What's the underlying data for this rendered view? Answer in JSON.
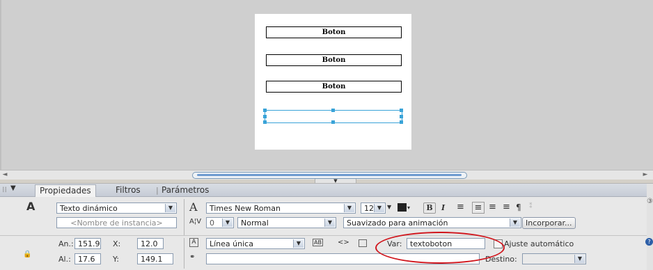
{
  "stage": {
    "buttons": [
      {
        "label": "Boton"
      },
      {
        "label": "Boton"
      },
      {
        "label": "Boton"
      }
    ]
  },
  "scrollbar": {
    "left_arrow": "◄",
    "right_arrow": "►"
  },
  "panel": {
    "menu_glyph": "▼",
    "tabs": [
      {
        "label": "Propiedades"
      },
      {
        "label": "Filtros"
      },
      {
        "label": "Parámetros"
      }
    ],
    "text_type": "Texto dinámico",
    "instance_placeholder": "<Nombre de instancia>",
    "font_name": "Times New Roman",
    "font_size": "12",
    "letter_spacing": "0",
    "char_position": "Normal",
    "antialias": "Suavizado para animación",
    "embed_button": "Incorporar...",
    "width_label": "An.:",
    "width_value": "151.9",
    "height_label": "Al.:",
    "height_value": "17.6",
    "x_label": "X:",
    "x_value": "12.0",
    "y_label": "Y:",
    "y_value": "149.1",
    "line_type": "Línea única",
    "var_label": "Var:",
    "var_value": "textoboton",
    "autofit_label": "Ajuste automático",
    "destino_label": "Destino:",
    "bold_glyph": "B",
    "italic_glyph": "I",
    "paragraph_glyph": "¶",
    "text_tool_glyph": "A",
    "selectable_glyph": "AB",
    "html_glyph": "<>"
  },
  "annotation": {
    "color": "#d0151c"
  }
}
